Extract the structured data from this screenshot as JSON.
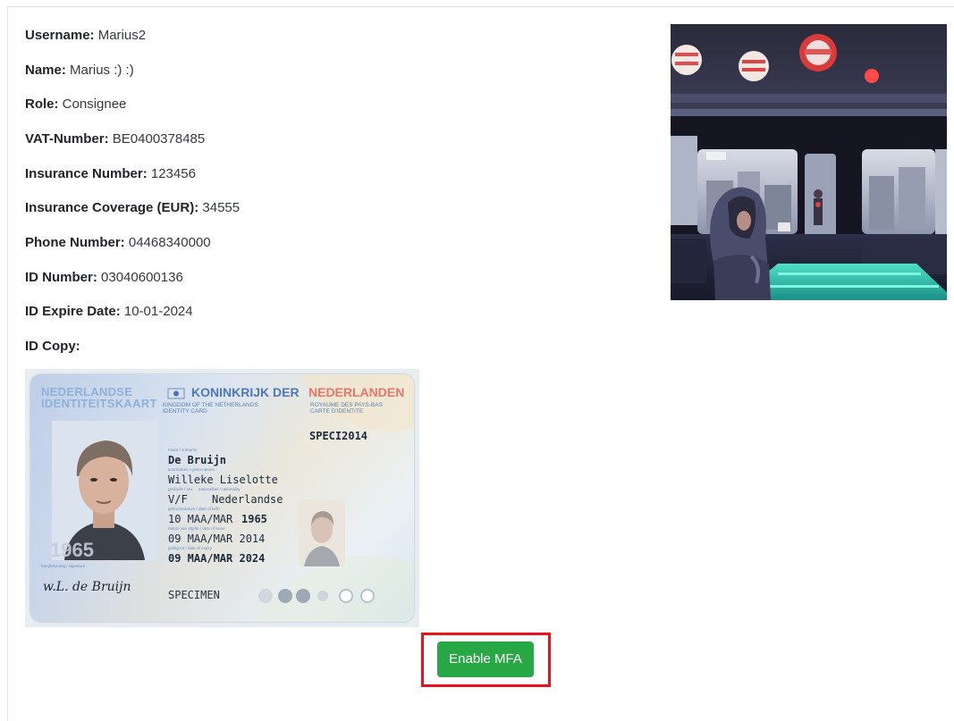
{
  "profile": {
    "fields": [
      {
        "label": "Username:",
        "value": "Marius2"
      },
      {
        "label": "Name:",
        "value": "Marius :) :)"
      },
      {
        "label": "Role:",
        "value": "Consignee"
      },
      {
        "label": "VAT-Number:",
        "value": "BE0400378485"
      },
      {
        "label": "Insurance Number:",
        "value": "123456"
      },
      {
        "label": "Insurance Coverage (EUR):",
        "value": "34555"
      },
      {
        "label": "Phone Number:",
        "value": "04468340000"
      },
      {
        "label": "ID Number:",
        "value": "03040600136"
      },
      {
        "label": "ID Expire Date:",
        "value": "10-01-2024"
      }
    ],
    "id_copy_label": "ID Copy:"
  },
  "id_card": {
    "title_left_1": "NEDERLANDSE",
    "title_left_2": "IDENTITEITSKAART",
    "title_right_1": "KONINKRIJK DER",
    "title_right_2": "NEDERLANDEN",
    "sub_en_1": "KINGDOM OF THE NETHERLANDS",
    "sub_en_2": "IDENTITY CARD",
    "sub_fr_1": "ROYAUME DES PAYS-BAS",
    "sub_fr_2": "CARTE D'IDENTITE",
    "document_no": "SPECI2014",
    "surname": "De Bruijn",
    "given_names": "Willeke Liselotte",
    "sex": "V/F",
    "nationality": "Nederlandse",
    "birth_date": "10 MAA/MAR",
    "birth_year": "1965",
    "issue_date": "09 MAA/MAR 2014",
    "expiry_date": "09 MAA/MAR 2024",
    "specimen": "SPECIMEN",
    "signature": "w.L. de Bruijn",
    "watermark_year": "1965"
  },
  "actions": {
    "enable_mfa_label": "Enable MFA"
  },
  "colors": {
    "button_green": "#28a745",
    "highlight_red": "#e8131b"
  }
}
